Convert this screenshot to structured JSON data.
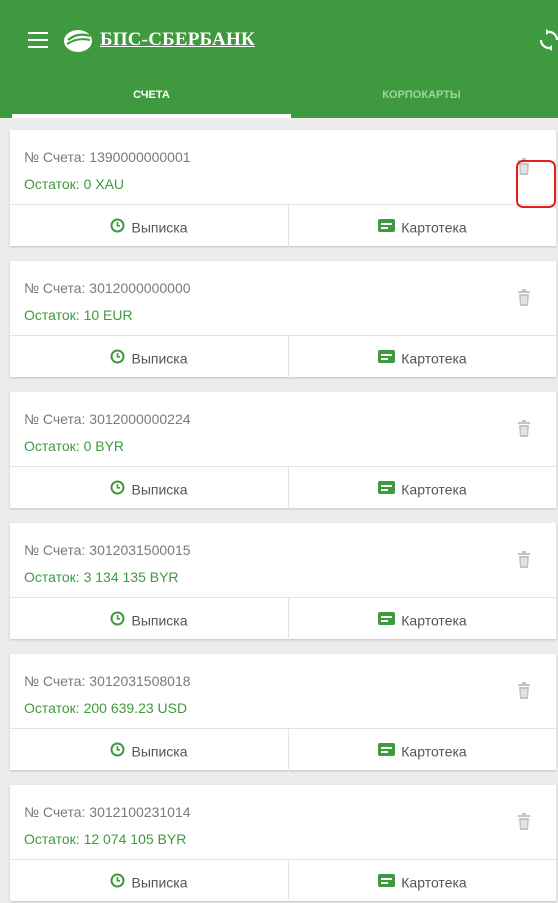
{
  "toolbar": {
    "menu_icon": "hamburger-menu-icon",
    "logo_icon": "sberbank-logo-icon",
    "brand": "БПС-СБЕРБАНК",
    "sync_icon": "sync-icon"
  },
  "tabs": [
    {
      "label": "СЧЕТА",
      "active": true
    },
    {
      "label": "КОРПОКАРТЫ",
      "active": false
    }
  ],
  "accounts": [
    {
      "number": "№ Счета: 1390000000001",
      "balance": "Остаток: 0 XAU"
    },
    {
      "number": "№ Счета: 3012000000000",
      "balance": "Остаток: 10 EUR"
    },
    {
      "number": "№ Счета: 3012000000224",
      "balance": "Остаток: 0 BYR"
    },
    {
      "number": "№ Счета: 3012031500015",
      "balance": "Остаток: 3 134 135 BYR"
    },
    {
      "number": "№ Счета: 3012031508018",
      "balance": "Остаток: 200 639.23 USD"
    },
    {
      "number": "№ Счета: 3012100231014",
      "balance": "Остаток: 12 074 105 BYR"
    }
  ],
  "actions": {
    "statement_label": "Выписка",
    "statement_icon": "clock-icon",
    "cardfile_label": "Картотека",
    "cardfile_icon": "card-file-icon"
  },
  "delete_icon": "trash-icon",
  "colors": {
    "primary_green": "#3f9a3f",
    "highlight": "#e02020"
  }
}
